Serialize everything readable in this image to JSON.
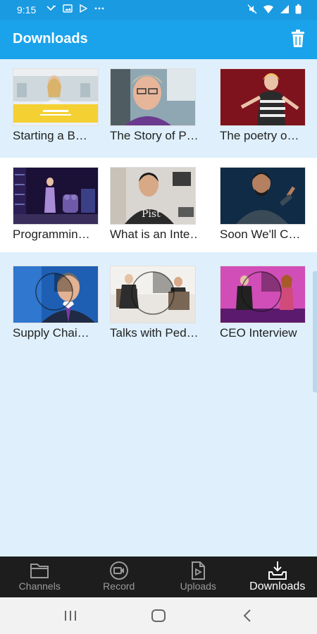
{
  "status_bar": {
    "time": "9:15",
    "notification_icons": [
      "missed-call-icon",
      "image-icon",
      "play-store-icon",
      "more-dots-icon"
    ],
    "system_icons": [
      "mute-icon",
      "wifi-icon",
      "signal-icon",
      "battery-icon"
    ]
  },
  "app_bar": {
    "title": "Downloads",
    "action_icon": "trash-icon"
  },
  "videos": [
    {
      "label": "Starting a B…"
    },
    {
      "label": "The Story of P…"
    },
    {
      "label": "The poetry o…"
    },
    {
      "label": "Programmin…"
    },
    {
      "label": "What is an Inte…"
    },
    {
      "label": "Soon We'll C…"
    },
    {
      "label": "Supply Chai…"
    },
    {
      "label": "Talks with Ped…"
    },
    {
      "label": "CEO Interview"
    }
  ],
  "bottom_nav": {
    "items": [
      {
        "label": "Channels",
        "icon": "folder-icon",
        "active": false
      },
      {
        "label": "Record",
        "icon": "video-camera-icon",
        "active": false
      },
      {
        "label": "Uploads",
        "icon": "upload-file-icon",
        "active": false
      },
      {
        "label": "Downloads",
        "icon": "download-tray-icon",
        "active": true
      }
    ]
  },
  "colors": {
    "status_bar": "#1a9ae0",
    "app_bar": "#1aa3ea",
    "background": "#dff0fc",
    "nav_background": "#1d1d1d"
  }
}
